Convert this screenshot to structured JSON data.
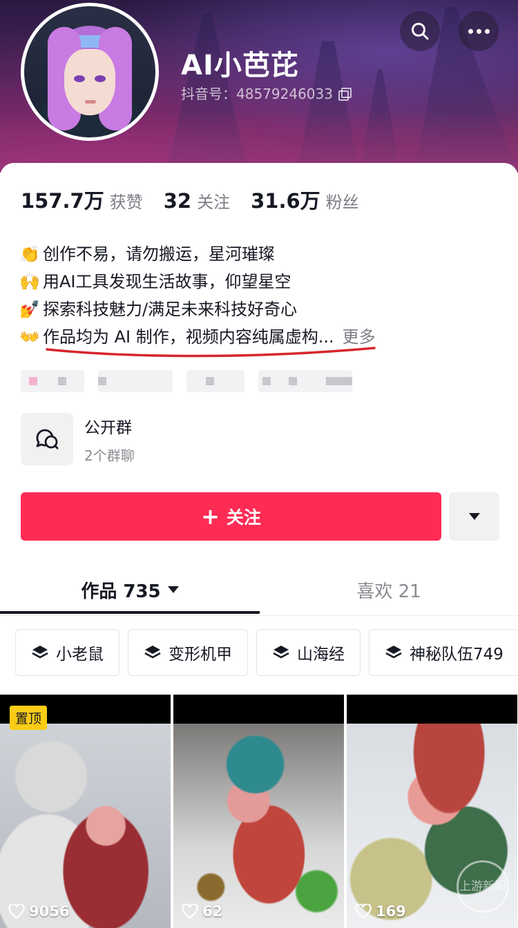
{
  "profile": {
    "name": "AI小芭芘",
    "douyin_id": "抖音号：48579246033",
    "stats": [
      {
        "num": "157.7万",
        "label": "获赞"
      },
      {
        "num": "32",
        "label": "关注"
      },
      {
        "num": "31.6万",
        "label": "粉丝"
      }
    ],
    "bio": [
      {
        "emoji": "👏",
        "text": "创作不易，请勿搬运，星河璀璨"
      },
      {
        "emoji": "🙌",
        "text": "用AI工具发现生活故事，仰望星空"
      },
      {
        "emoji": "💅",
        "text": "探索科技魅力/满足未来科技好奇心"
      },
      {
        "emoji": "👐",
        "text": "作品均为 AI 制作，视频内容纯属虚构..."
      }
    ],
    "bio_more": "更多"
  },
  "group": {
    "title": "公开群",
    "subtitle": "2个群聊"
  },
  "actions": {
    "follow_label": "关注",
    "follow_plus": "+"
  },
  "tabs": {
    "works": "作品 735",
    "likes": "喜欢 21"
  },
  "collections": [
    "小老鼠",
    "变形机甲",
    "山海经",
    "神秘队伍749"
  ],
  "videos": [
    {
      "pinned": "置顶",
      "likes": "9056"
    },
    {
      "likes": "62"
    },
    {
      "likes": "169",
      "watermark": "上游新闻"
    }
  ],
  "colors": {
    "accent": "#fe2c55",
    "underline_annotation": "#d6262c",
    "pinned_badge": "#facc15"
  },
  "icons": [
    "search-icon",
    "more-icon",
    "copy-icon",
    "group-chat-icon",
    "chevron-down-icon",
    "layers-icon",
    "heart-icon"
  ]
}
